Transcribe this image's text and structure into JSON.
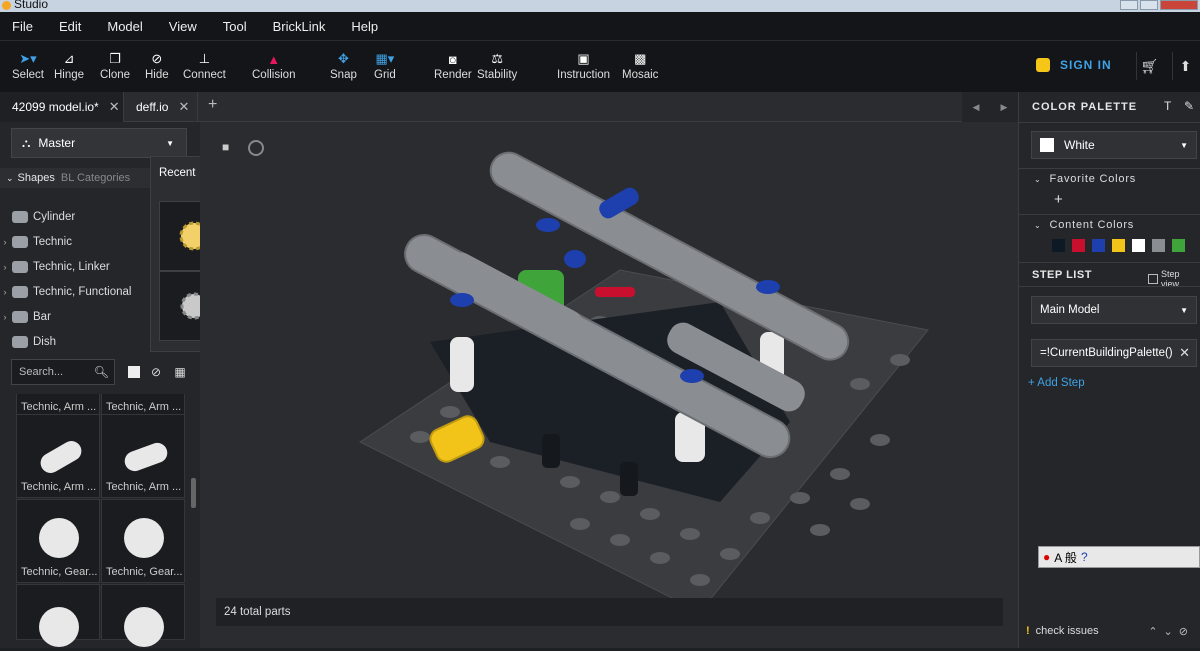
{
  "window": {
    "title": "Studio"
  },
  "menu": [
    "File",
    "Edit",
    "Model",
    "View",
    "Tool",
    "BrickLink",
    "Help"
  ],
  "toolbar": {
    "select": "Select",
    "hinge": "Hinge",
    "clone": "Clone",
    "hide": "Hide",
    "connect": "Connect",
    "collision": "Collision",
    "snap": "Snap",
    "grid": "Grid",
    "render": "Render",
    "stability": "Stability",
    "instruction": "Instruction",
    "mosaic": "Mosaic",
    "sign_in": "SIGN IN"
  },
  "tabs": [
    {
      "label": "42099 model.io*"
    },
    {
      "label": "deff.io"
    }
  ],
  "left": {
    "palette": "Master",
    "shapes_tab": "Shapes",
    "bl_tab": "BL Categories",
    "categories": [
      "Cylinder",
      "Technic",
      "Technic, Linker",
      "Technic, Functional",
      "Bar",
      "Dish"
    ],
    "recent_label": "Recent",
    "search_placeholder": "Search...",
    "parts": [
      "Technic, Arm ...",
      "Technic, Arm ...",
      "Technic, Arm ...",
      "Technic, Arm ...",
      "Technic, Gear...",
      "Technic, Gear..."
    ]
  },
  "status": {
    "parts_count": "24 total parts"
  },
  "right": {
    "color_palette_title": "COLOR PALETTE",
    "selected_color": "White",
    "favorite_colors": "Favorite Colors",
    "content_colors": "Content Colors",
    "content_swatches": [
      "#0d1a26",
      "#c8102e",
      "#1e3fae",
      "#f2c318",
      "#ffffff",
      "#8a8d91",
      "#3fa43a"
    ],
    "step_list_title": "STEP LIST",
    "step_view": "Step view",
    "main_model": "Main Model",
    "palette_expression": "=!CurrentBuildingPalette()",
    "add_step": "+ Add Step",
    "check_issues": "check issues"
  },
  "ime": {
    "label": "A 般"
  },
  "colors": {
    "accent": "#3fa2e6",
    "warning": "#f5c518",
    "collision": "#e8175d"
  }
}
